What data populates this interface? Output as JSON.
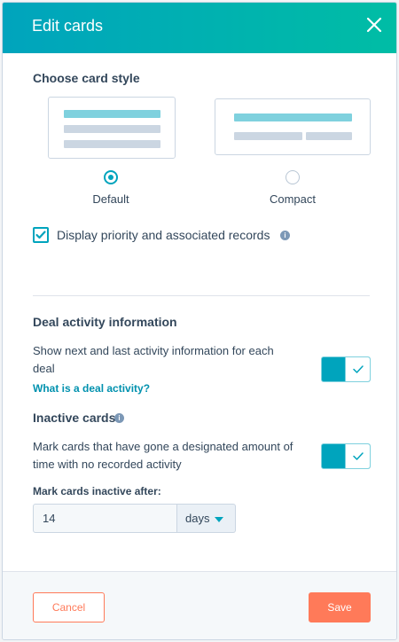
{
  "header": {
    "title": "Edit cards"
  },
  "card_style": {
    "title": "Choose card style",
    "options": [
      {
        "label": "Default",
        "selected": true
      },
      {
        "label": "Compact",
        "selected": false
      }
    ],
    "checkbox_label": "Display priority and associated records",
    "checkbox_checked": true
  },
  "deal_activity": {
    "title": "Deal activity information",
    "line1": "Show next and last activity information for each",
    "line2": "deal",
    "link": "What is a deal activity?",
    "toggle_on": true
  },
  "inactive": {
    "title": "Inactive cards",
    "line1": "Mark cards that have gone a designated amount of",
    "line2": "time with no recorded activity",
    "toggle_on": true,
    "after_label": "Mark cards inactive after:",
    "value": "14",
    "unit": "days"
  },
  "footer": {
    "cancel": "Cancel",
    "save": "Save"
  },
  "colors": {
    "accent": "#00a4bd",
    "header_end": "#00bda5",
    "action": "#ff7a59"
  }
}
